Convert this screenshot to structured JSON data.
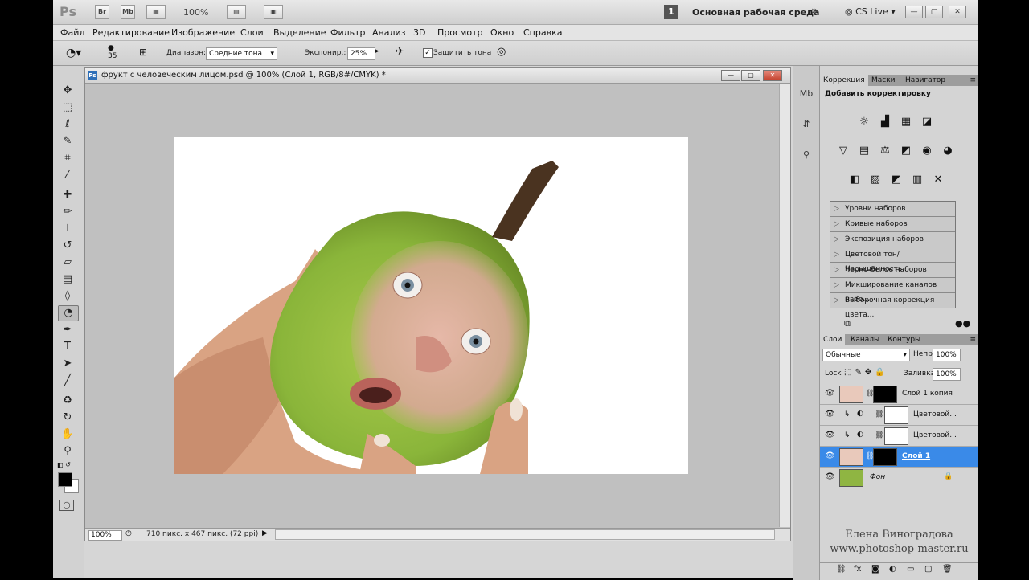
{
  "appbar": {
    "logo": "Ps",
    "bridge": "Br",
    "minibridge": "Mb",
    "zoom": "100%",
    "workspace_num": "1",
    "workspace": "Основная рабочая среда",
    "more": "»",
    "cslive": "CS Live"
  },
  "menu": [
    "Файл",
    "Редактирование",
    "Изображение",
    "Слои",
    "Выделение",
    "Фильтр",
    "Анализ",
    "3D",
    "Просмотр",
    "Окно",
    "Справка"
  ],
  "options": {
    "brush_size": "35",
    "range_label": "Диапазон:",
    "range_value": "Средние тона",
    "exposure_label": "Экспонир.:",
    "exposure_value": "25%",
    "protect_label": "Защитить тона",
    "protect_checked": "✓"
  },
  "document": {
    "title": "фрукт с человеческим лицом.psd @ 100% (Слой 1, RGB/8#/CMYK) *",
    "zoom": "100%",
    "info": "710 пикс. x 467 пикс. (72 ppi)"
  },
  "adjust_panel": {
    "tabs": [
      "Коррекция",
      "Маски",
      "Навигатор"
    ],
    "heading": "Добавить корректировку",
    "presets": [
      "Уровни наборов",
      "Кривые наборов",
      "Экспозиция наборов",
      "Цветовой тон/Насыщенность...",
      "Черно-белое наборов",
      "Микширование каналов набо...",
      "Выборочная коррекция цвета..."
    ]
  },
  "layers_panel": {
    "tabs": [
      "Слои",
      "Каналы",
      "Контуры"
    ],
    "blend_mode": "Обычные",
    "opacity_label": "Непр",
    "opacity": "100%",
    "lock_label": "Lock",
    "fill_label": "Заливка",
    "fill": "100%",
    "layers": [
      {
        "name": "Слой 1 копия",
        "selected": false
      },
      {
        "name": "Цветовой...",
        "selected": false
      },
      {
        "name": "Цветовой...",
        "selected": false
      },
      {
        "name": "Слой 1",
        "selected": true
      },
      {
        "name": "Фон",
        "selected": false
      }
    ]
  },
  "watermark": {
    "author": "Елена Виноградова",
    "site": "www.photoshop-master.ru"
  },
  "colors": {
    "accent": "#3a8ae8"
  }
}
